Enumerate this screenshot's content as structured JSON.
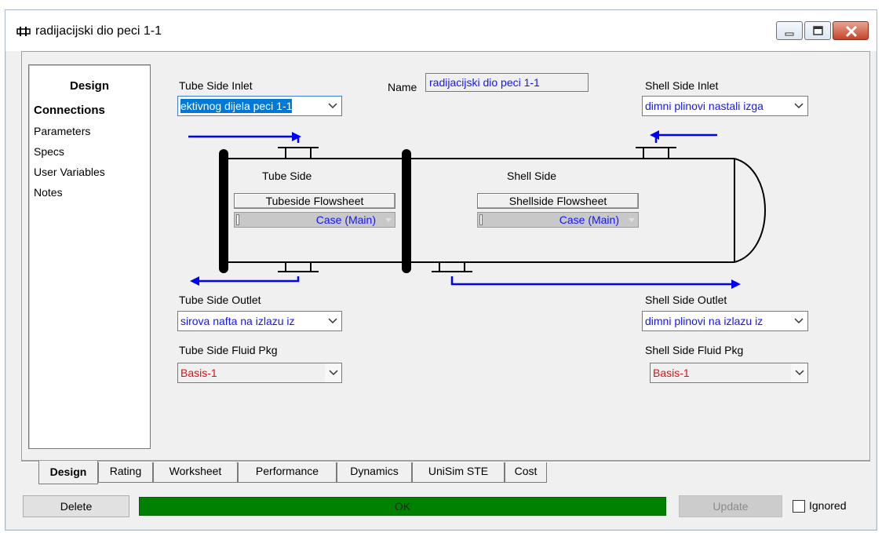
{
  "window": {
    "title": "radijacijski dio peci 1-1"
  },
  "sidebar": {
    "heading": "Design",
    "items": [
      {
        "label": "Connections",
        "active": true
      },
      {
        "label": "Parameters"
      },
      {
        "label": "Specs"
      },
      {
        "label": "User Variables"
      },
      {
        "label": "Notes"
      }
    ]
  },
  "connections": {
    "tube_inlet_label": "Tube Side Inlet",
    "tube_inlet_value": "ektivnog dijela peci 1-1",
    "name_label": "Name",
    "name_value": "radijacijski dio peci 1-1",
    "shell_inlet_label": "Shell Side Inlet",
    "shell_inlet_value": "dimni plinovi nastali izga",
    "tube_side_label": "Tube Side",
    "shell_side_label": "Shell Side",
    "tubeside_flowsheet_button": "Tubeside Flowsheet",
    "shellside_flowsheet_button": "Shellside Flowsheet",
    "tubeside_case": "Case (Main)",
    "shellside_case": "Case (Main)",
    "tube_outlet_label": "Tube Side Outlet",
    "tube_outlet_value": "sirova nafta na izlazu iz",
    "shell_outlet_label": "Shell Side Outlet",
    "shell_outlet_value": "dimni plinovi na izlazu iz",
    "tube_fluid_label": "Tube Side Fluid Pkg",
    "tube_fluid_value": "Basis-1",
    "shell_fluid_label": "Shell Side Fluid Pkg",
    "shell_fluid_value": "Basis-1"
  },
  "tabs": [
    "Design",
    "Rating",
    "Worksheet",
    "Performance",
    "Dynamics",
    "UniSim STE",
    "Cost"
  ],
  "footer": {
    "delete_label": "Delete",
    "status_text": "OK",
    "update_label": "Update",
    "ignored_label": "Ignored",
    "ignored_checked": false
  },
  "colors": {
    "stream_blue": "#0000ff",
    "status_green": "#008000",
    "fluid_pkg_red": "#e01010",
    "value_blue": "#1414ff"
  }
}
